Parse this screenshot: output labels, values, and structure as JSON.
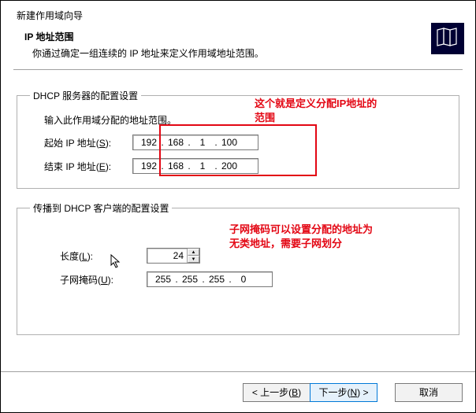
{
  "window": {
    "title": "新建作用域向导",
    "section_title": "IP 地址范围",
    "section_desc": "你通过确定一组连续的 IP 地址来定义作用域地址范围。"
  },
  "group1": {
    "legend": "DHCP 服务器的配置设置",
    "instruction": "输入此作用域分配的地址范围。",
    "start_label_pre": "起始 IP 地址(",
    "start_label_key": "S",
    "start_label_post": "):",
    "end_label_pre": "结束 IP 地址(",
    "end_label_key": "E",
    "end_label_post": "):",
    "start_ip": {
      "o1": "192",
      "o2": "168",
      "o3": "1",
      "o4": "100"
    },
    "end_ip": {
      "o1": "192",
      "o2": "168",
      "o3": "1",
      "o4": "200"
    }
  },
  "group2": {
    "legend": "传播到 DHCP 客户端的配置设置",
    "length_label_pre": "长度(",
    "length_label_key": "L",
    "length_label_post": "):",
    "length_value": "24",
    "mask_label_pre": "子网掩码(",
    "mask_label_key": "U",
    "mask_label_post": "):",
    "mask": {
      "o1": "255",
      "o2": "255",
      "o3": "255",
      "o4": "0"
    }
  },
  "annotations": {
    "a1_line1": "这个就是定义分配IP地址的",
    "a1_line2": "范围",
    "a2_line1": "子网掩码可以设置分配的地址为",
    "a2_line2": "无类地址，需要子网划分"
  },
  "footer": {
    "back_pre": "< 上一步(",
    "back_key": "B",
    "back_post": ")",
    "next_pre": "下一步(",
    "next_key": "N",
    "next_post": ") >",
    "cancel": "取消"
  },
  "glyphs": {
    "dot": ".",
    "up": "▲",
    "down": "▼"
  }
}
